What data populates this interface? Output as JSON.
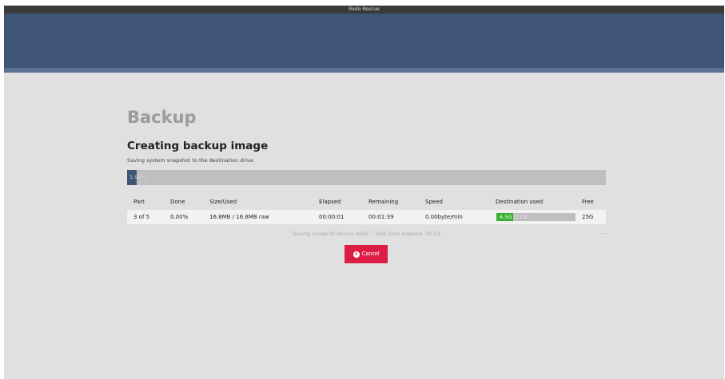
{
  "window": {
    "title": "Redo Rescue"
  },
  "page": {
    "title": "Backup",
    "section_title": "Creating backup image",
    "subtitle": "Saving system snapshot to the destination drive."
  },
  "progress": {
    "percent": 1.98,
    "label": "1.98%"
  },
  "table": {
    "headers": [
      "Part",
      "Done",
      "Size/Used",
      "Elapsed",
      "Remaining",
      "Speed",
      "Destination used",
      "Free"
    ],
    "rows": [
      {
        "part": "3 of 5",
        "done": "0.00%",
        "size_used": "16.8MB / 16.8MB raw",
        "elapsed": "00:00:01",
        "remaining": "00:01:39",
        "speed": "0.00byte/min",
        "destination_used": {
          "amount": "6.5G",
          "percent_label": "(21%)",
          "percent": 21
        },
        "free": "25G"
      }
    ]
  },
  "status": {
    "text": "Saving image of device sda3... Total time elapsed: 00:12",
    "more": "..."
  },
  "cancel_button": {
    "label": "Cancel",
    "icon": "times-circle-icon"
  },
  "colors": {
    "header": "#3e5575",
    "progress_fill": "#3e5575",
    "destination_fill": "#3aae2f",
    "cancel": "#dc1e44"
  }
}
